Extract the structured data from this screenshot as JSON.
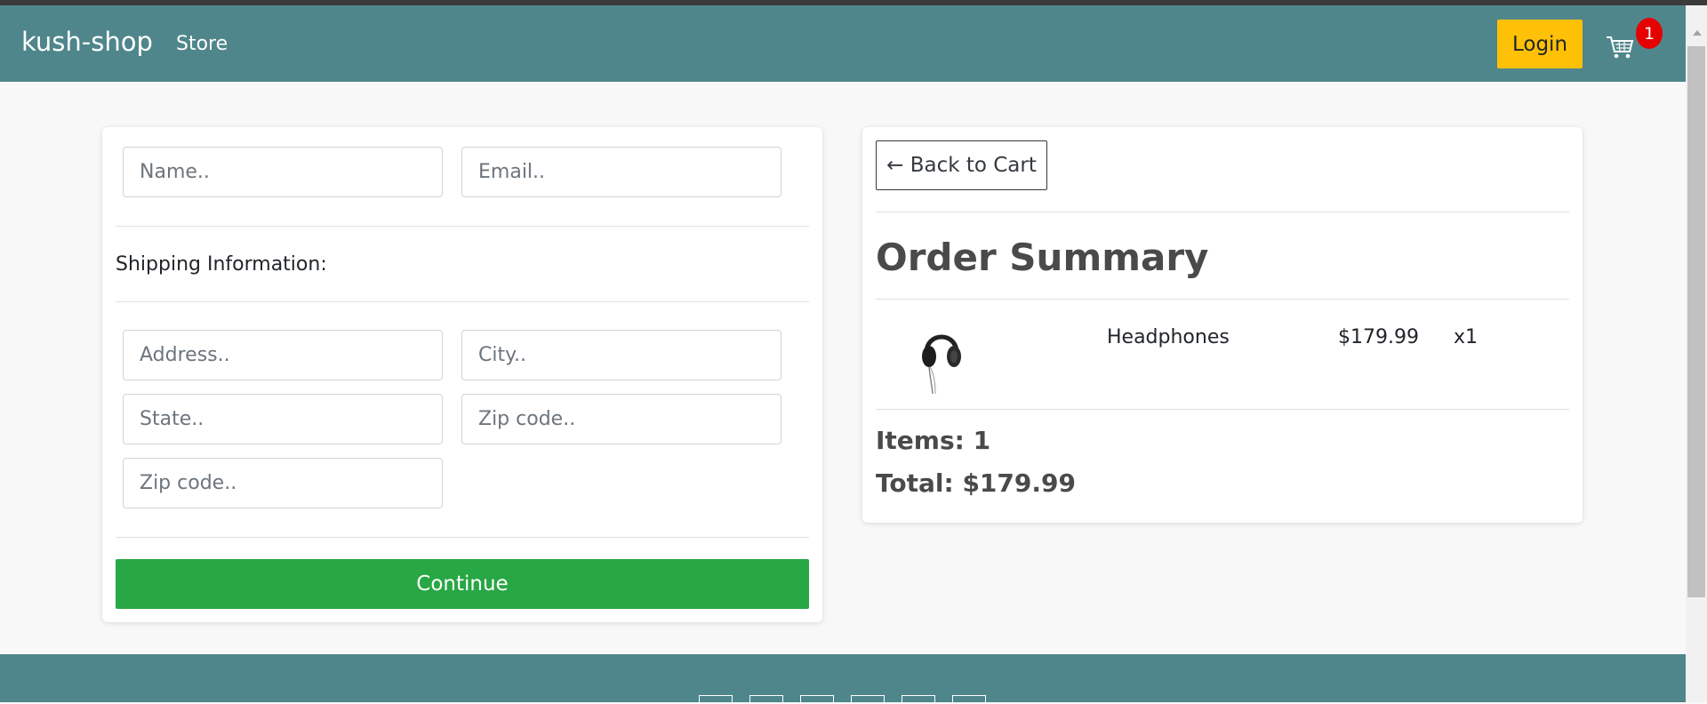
{
  "navbar": {
    "brand": "kush-shop",
    "store_link": "Store",
    "login_label": "Login",
    "cart_count": "1",
    "cart_icon": "shopping-cart-icon"
  },
  "checkout_form": {
    "name_placeholder": "Name..",
    "email_placeholder": "Email..",
    "shipping_label": "Shipping Information:",
    "address_placeholder": "Address..",
    "city_placeholder": "City..",
    "state_placeholder": "State..",
    "zip_placeholder": "Zip code..",
    "zip2_placeholder": "Zip code..",
    "continue_label": "Continue"
  },
  "order_summary": {
    "back_label": "← Back to Cart",
    "title": "Order Summary",
    "items": [
      {
        "name": "Headphones",
        "price": "$179.99",
        "quantity": "x1",
        "image": "headphones-image"
      }
    ],
    "items_count_text": "Items: 1",
    "total_text": "Total: $179.99"
  },
  "colors": {
    "navbar": "#4f868b",
    "login": "#ffc107",
    "continue": "#28a745",
    "badge": "#e60000"
  }
}
